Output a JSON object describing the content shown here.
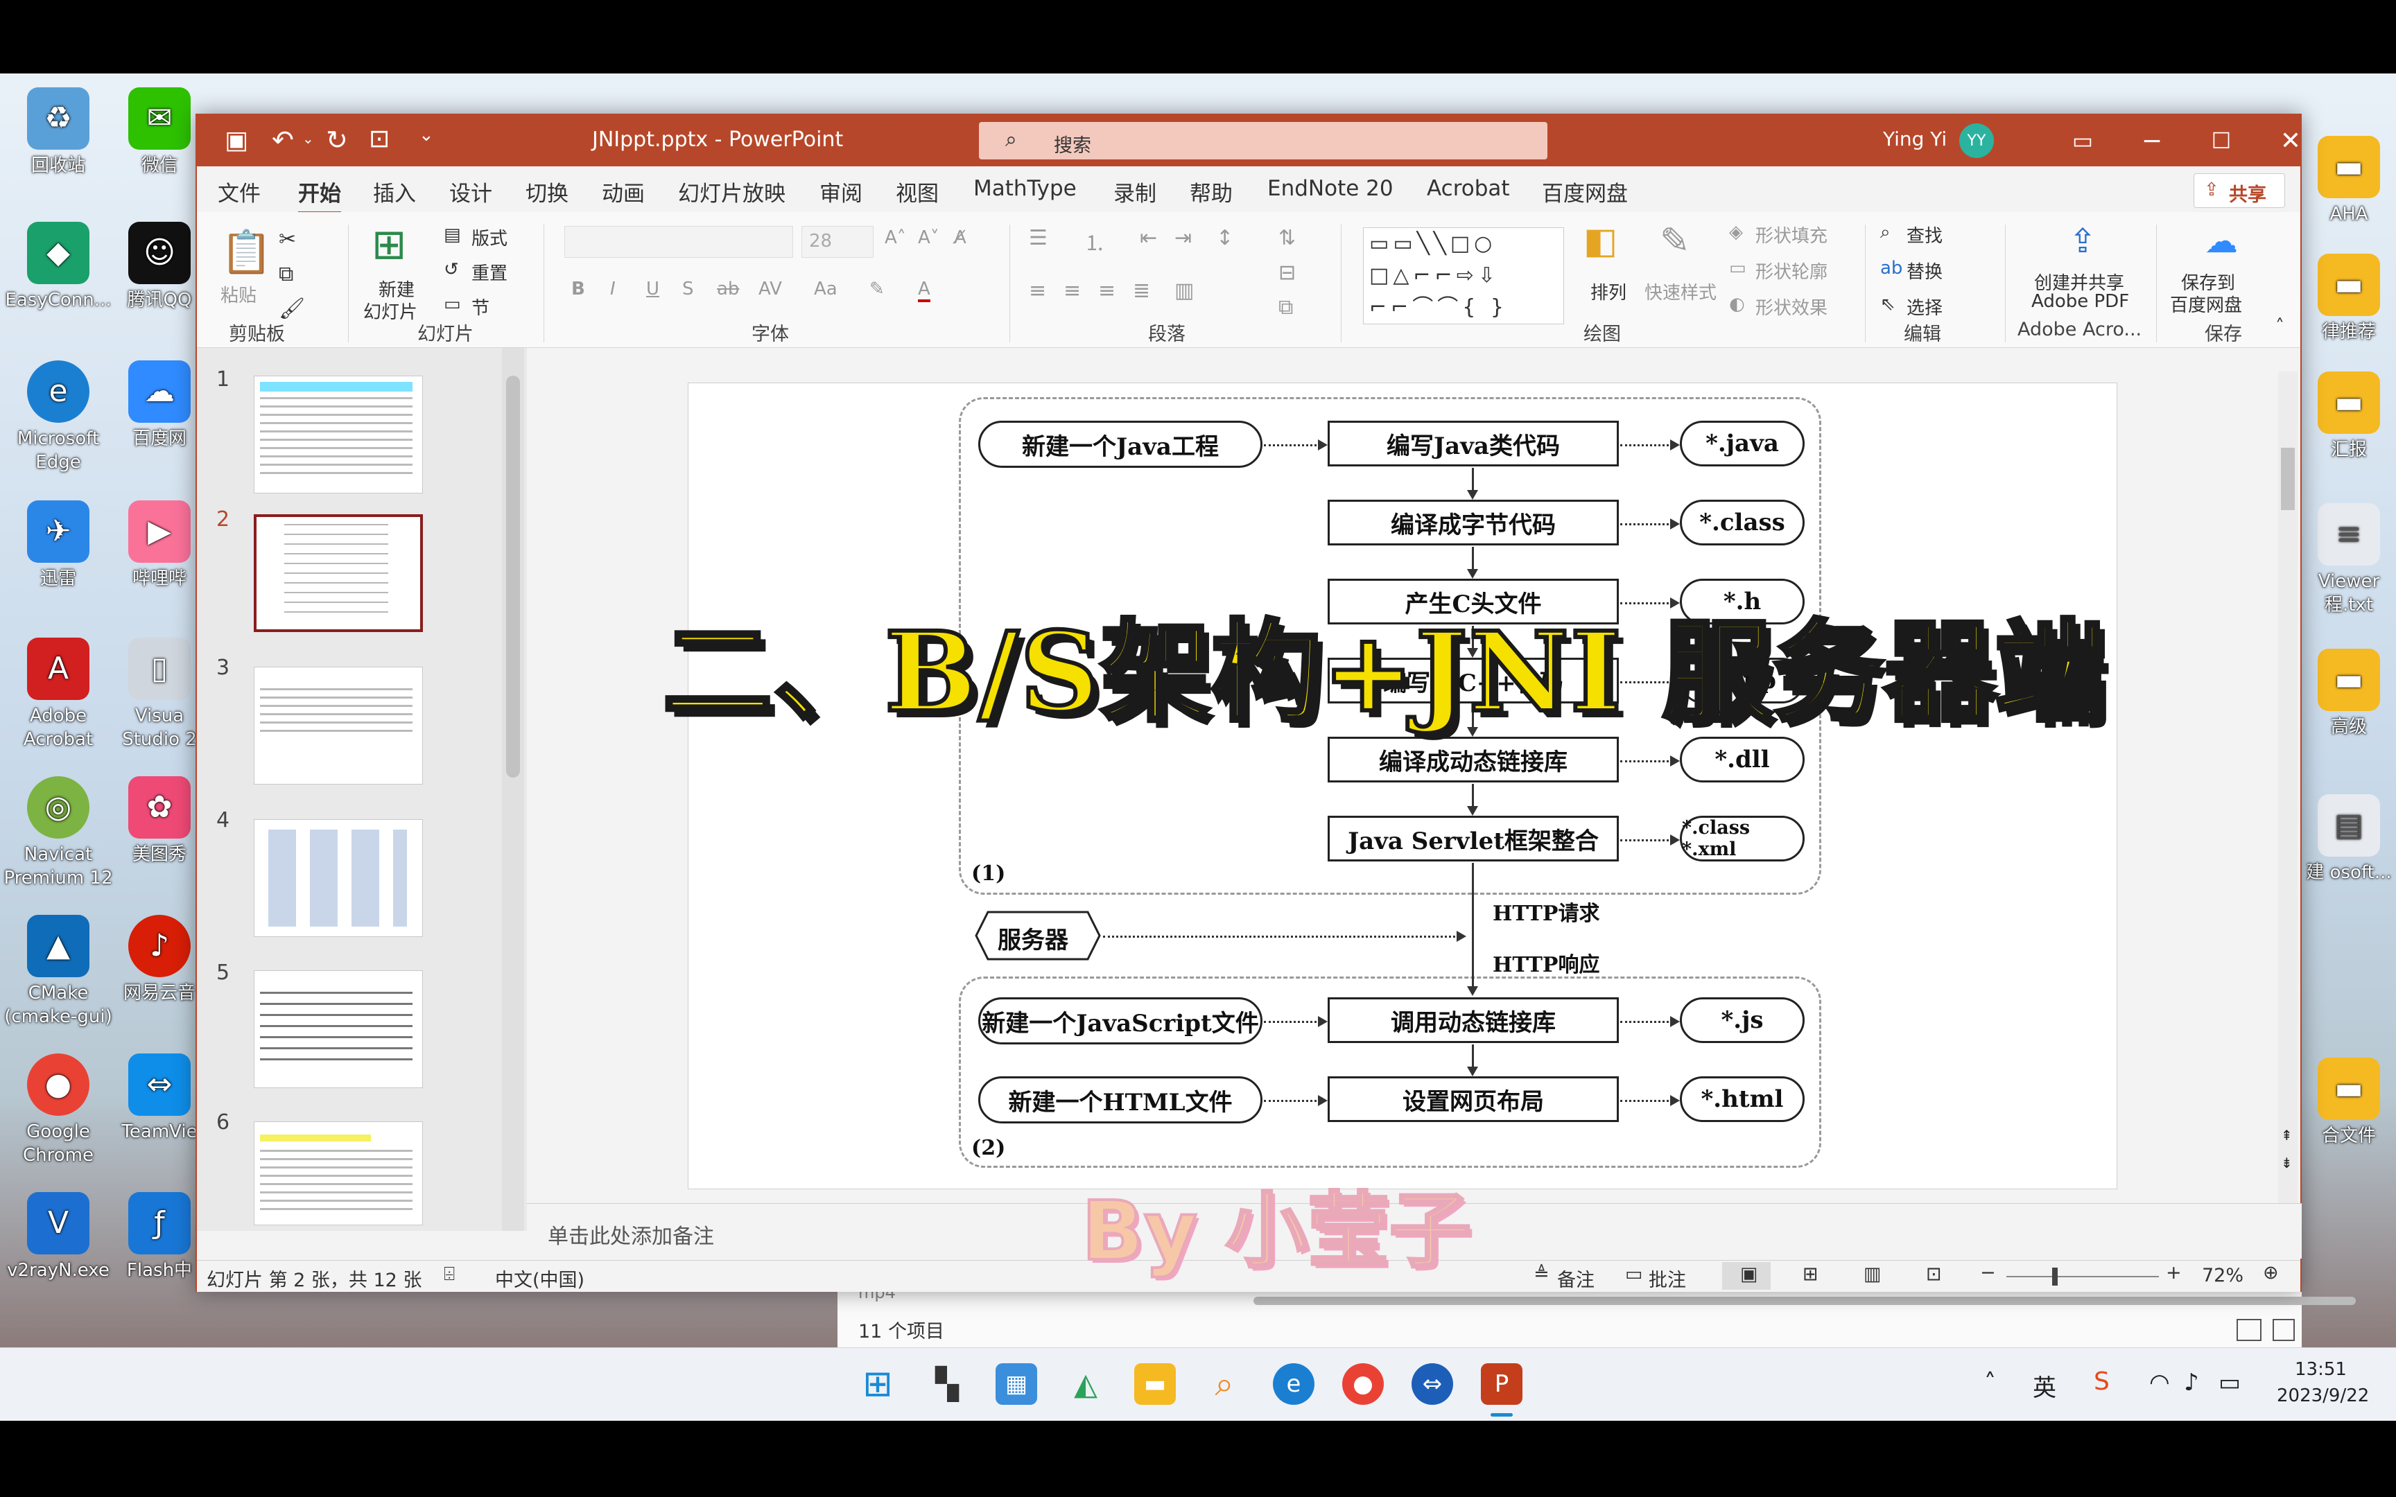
{
  "desktop": {
    "left_icons": [
      {
        "label": "回收站",
        "icon": "recycle-bin-icon",
        "color": "#5aa0d8"
      },
      {
        "label": "EasyConn...",
        "icon": "easyconnect-icon",
        "color": "#1aa06a"
      },
      {
        "label": "Microsoft Edge",
        "icon": "edge-icon",
        "color": "#1b7fd1"
      },
      {
        "label": "迅雷",
        "icon": "xunlei-icon",
        "color": "#2a87e8"
      },
      {
        "label": "Adobe Acrobat",
        "icon": "acrobat-icon",
        "color": "#d21f1f"
      },
      {
        "label": "Navicat Premium 12",
        "icon": "navicat-icon",
        "color": "#7cb342"
      },
      {
        "label": "CMake (cmake-gui)",
        "icon": "cmake-icon",
        "color": "#0f6cb8"
      },
      {
        "label": "Google Chrome",
        "icon": "chrome-icon",
        "color": "#e94235"
      },
      {
        "label": "v2rayN.exe",
        "icon": "v2rayn-icon",
        "color": "#1c6fd0"
      }
    ],
    "second_icons": [
      {
        "label": "微信",
        "icon": "wechat-icon",
        "color": "#2dc100"
      },
      {
        "label": "腾讯QQ",
        "icon": "qq-icon",
        "color": "#111111"
      },
      {
        "label": "百度网",
        "icon": "baidunetdisk-icon",
        "color": "#2f8bff"
      },
      {
        "label": "哔哩哔",
        "icon": "bilibili-icon",
        "color": "#fb7299"
      },
      {
        "label": "Visua Studio 2",
        "icon": "file-icon",
        "color": "#cfd6de"
      },
      {
        "label": "美图秀",
        "icon": "meitu-icon",
        "color": "#ef4a76"
      },
      {
        "label": "网易云音",
        "icon": "netease-music-icon",
        "color": "#d81e06"
      },
      {
        "label": "TeamVie",
        "icon": "teamviewer-icon",
        "color": "#0e8ee9"
      },
      {
        "label": "Flash中",
        "icon": "flash-icon",
        "color": "#1877d6"
      }
    ],
    "right_icons": [
      "AHA",
      "律推荐",
      "汇报",
      "Viewer 程.txt",
      "高级",
      "建 osoft...",
      "合文件"
    ],
    "partial_label": "mp4"
  },
  "explorer": {
    "status": "11 个项目"
  },
  "taskbar": {
    "time": "13:51",
    "date": "2023/9/22",
    "ime": "英",
    "pinned": [
      {
        "name": "start-icon",
        "color": "#1a8ad4"
      },
      {
        "name": "task-view-icon",
        "color": "#333333"
      },
      {
        "name": "control-panel-icon",
        "color": "#3b8edc"
      },
      {
        "name": "vpn-icon",
        "color": "#2aa35a"
      },
      {
        "name": "file-explorer-icon",
        "color": "#f5b922"
      },
      {
        "name": "search-app-icon",
        "color": "#f08a24"
      },
      {
        "name": "edge-taskbar-icon",
        "color": "#1b7fd1"
      },
      {
        "name": "chrome-taskbar-icon",
        "color": "#e94235"
      },
      {
        "name": "remote-icon",
        "color": "#1d5fb8"
      },
      {
        "name": "powerpoint-taskbar-icon",
        "color": "#c43e1c"
      }
    ]
  },
  "ppt": {
    "title": "JNIppt.pptx  -  PowerPoint",
    "search_placeholder": "搜索",
    "user": "Ying Yi",
    "avatar": "YY",
    "accent": "#b7472a",
    "menu": [
      "文件",
      "开始",
      "插入",
      "设计",
      "切换",
      "动画",
      "幻灯片放映",
      "审阅",
      "视图",
      "MathType",
      "录制",
      "帮助",
      "EndNote 20",
      "Acrobat",
      "百度网盘"
    ],
    "share": "共享",
    "ribbon": {
      "clipboard": {
        "paste": "粘贴",
        "label": "剪贴板"
      },
      "slides": {
        "new": "新建",
        "new2": "幻灯片",
        "layout": "版式",
        "reset": "重置",
        "section": "节",
        "label": "幻灯片"
      },
      "font": {
        "size": "28",
        "label": "字体"
      },
      "paragraph": {
        "label": "段落"
      },
      "drawing": {
        "arrange": "排列",
        "quick_styles": "快速样式",
        "fill": "形状填充",
        "outline": "形状轮廓",
        "effects": "形状效果",
        "label": "绘图"
      },
      "editing": {
        "find": "查找",
        "replace": "替换",
        "select": "选择",
        "label": "编辑"
      },
      "adobe": {
        "line1": "创建并共享",
        "line2": "Adobe PDF",
        "label": "Adobe Acro..."
      },
      "save": {
        "line1": "保存到",
        "line2": "百度网盘",
        "label": "保存"
      }
    },
    "thumbnails": [
      "1",
      "2",
      "3",
      "4",
      "5",
      "6"
    ],
    "notes_placeholder": "单击此处添加备注",
    "status": {
      "slide": "幻灯片 第 2 张，共 12 张",
      "lang": "中文(中国)",
      "notes": "备注",
      "comments": "批注",
      "zoom": "72%"
    }
  },
  "slide": {
    "left_nodes": [
      "新建一个Java工程",
      "新建一个JavaScript文件",
      "新建一个HTML文件"
    ],
    "center_nodes": [
      "编写Java类代码",
      "编译成字节代码",
      "产生C头文件",
      "编写C/C++代码",
      "编译成动态链接库",
      "Java Servlet框架整合",
      "调用动态链接库",
      "设置网页布局"
    ],
    "right_nodes": [
      "*.java",
      "*.class",
      "*.h",
      "*.cpp",
      "*.dll",
      "*.class *.xml",
      "*.js",
      "*.html"
    ],
    "server": "服务器",
    "http_req": "HTTP请求",
    "http_resp": "HTTP响应",
    "group1": "(1)",
    "group2": "(2)"
  },
  "overlays": {
    "title": "二、B/S架构+JNI 服务器端",
    "byline": "By 小莹子"
  }
}
